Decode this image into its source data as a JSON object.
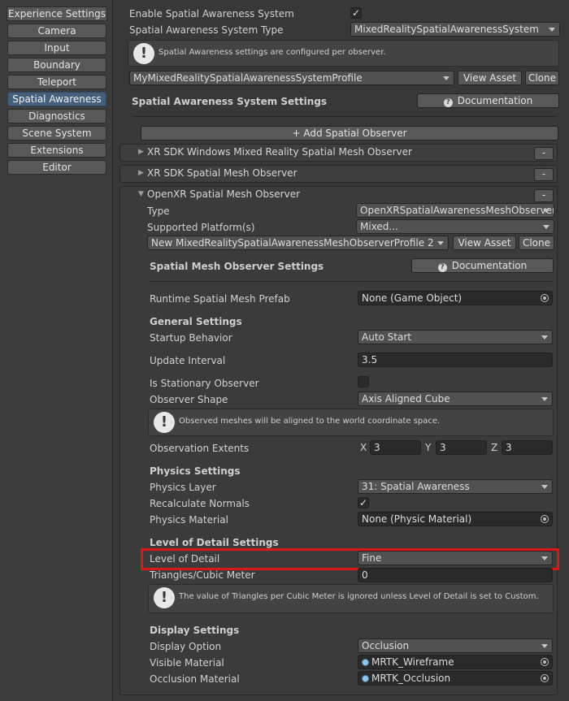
{
  "sidebar": {
    "items": [
      {
        "label": "Experience Settings",
        "active": false
      },
      {
        "label": "Camera",
        "active": false
      },
      {
        "label": "Input",
        "active": false
      },
      {
        "label": "Boundary",
        "active": false
      },
      {
        "label": "Teleport",
        "active": false
      },
      {
        "label": "Spatial Awareness",
        "active": true
      },
      {
        "label": "Diagnostics",
        "active": false
      },
      {
        "label": "Scene System",
        "active": false
      },
      {
        "label": "Extensions",
        "active": false
      },
      {
        "label": "Editor",
        "active": false
      }
    ]
  },
  "system": {
    "enable_label": "Enable Spatial Awareness System",
    "enable_checked": true,
    "type_label": "Spatial Awareness System Type",
    "type_value": "MixedRealitySpatialAwarenessSystem",
    "help_text": "Spatial Awareness settings are configured per observer.",
    "profile_value": "MyMixedRealitySpatialAwarenessSystemProfile",
    "view_asset": "View Asset",
    "clone": "Clone",
    "settings_title": "Spatial Awareness System Settings",
    "documentation": "Documentation",
    "add_observer": "+ Add Spatial Observer"
  },
  "observers": [
    {
      "title": "XR SDK Windows Mixed Reality Spatial Mesh Observer",
      "expanded": false
    },
    {
      "title": "XR SDK Spatial Mesh Observer",
      "expanded": false
    },
    {
      "title": "OpenXR Spatial Mesh Observer",
      "expanded": true
    }
  ],
  "remove_label": "-",
  "observer": {
    "type_label": "Type",
    "type_value": "OpenXRSpatialAwarenessMeshObserver",
    "platforms_label": "Supported Platform(s)",
    "platforms_value": "Mixed...",
    "profile_value": "New MixedRealitySpatialAwarenessMeshObserverProfile 2",
    "view_asset": "View Asset",
    "clone": "Clone",
    "settings_title": "Spatial Mesh Observer Settings",
    "documentation": "Documentation",
    "prefab_label": "Runtime Spatial Mesh Prefab",
    "prefab_value": "None (Game Object)",
    "general_title": "General Settings",
    "startup_label": "Startup Behavior",
    "startup_value": "Auto Start",
    "interval_label": "Update Interval",
    "interval_value": "3.5",
    "stationary_label": "Is Stationary Observer",
    "stationary_checked": false,
    "shape_label": "Observer Shape",
    "shape_value": "Axis Aligned Cube",
    "shape_help": "Observed meshes will be aligned to the world coordinate space.",
    "extents_label": "Observation Extents",
    "extents": {
      "x_label": "X",
      "x": "3",
      "y_label": "Y",
      "y": "3",
      "z_label": "Z",
      "z": "3"
    },
    "physics_title": "Physics Settings",
    "layer_label": "Physics Layer",
    "layer_value": "31: Spatial Awareness",
    "normals_label": "Recalculate Normals",
    "normals_checked": true,
    "material_label": "Physics Material",
    "material_value": "None (Physic Material)",
    "lod_title": "Level of Detail Settings",
    "lod_label": "Level of Detail",
    "lod_value": "Fine",
    "triangles_label": "Triangles/Cubic Meter",
    "triangles_value": "0",
    "lod_help": "The value of Triangles per Cubic Meter is ignored unless Level of Detail is set to Custom.",
    "display_title": "Display Settings",
    "display_option_label": "Display Option",
    "display_option_value": "Occlusion",
    "visible_mat_label": "Visible Material",
    "visible_mat_value": "MRTK_Wireframe",
    "occlusion_mat_label": "Occlusion Material",
    "occlusion_mat_value": "MRTK_Occlusion"
  },
  "colors": {
    "panel_bg": "#383838",
    "active_tab": "#46607c",
    "highlight": "#e0151a"
  },
  "icons": {
    "checkmark": "✓",
    "info": "!",
    "doc": "?",
    "foldout_collapsed": "▶",
    "foldout_expanded": "▼"
  }
}
